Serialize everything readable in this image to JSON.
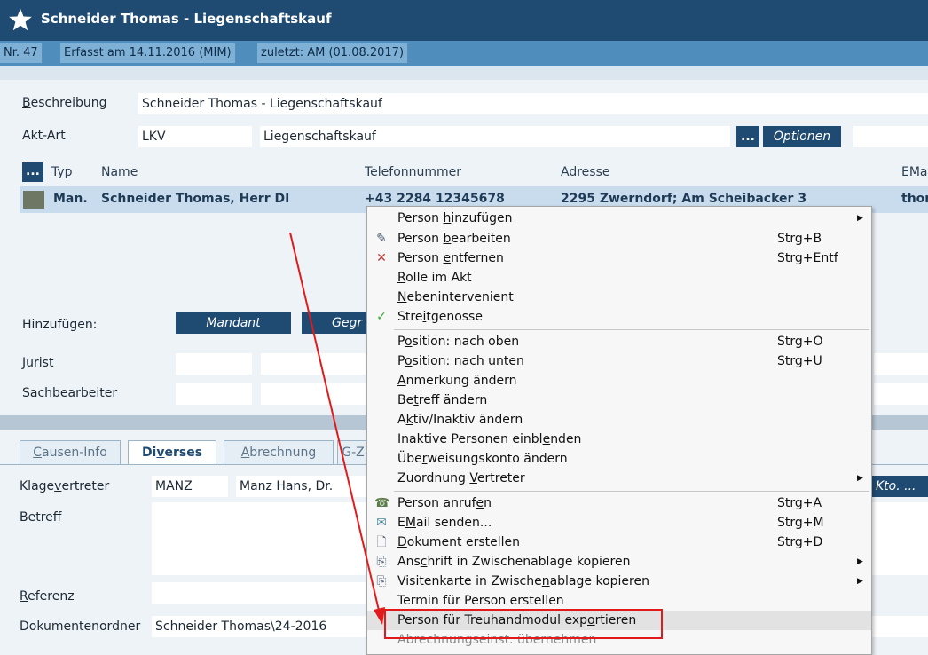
{
  "window": {
    "title": "Schneider Thomas - Liegenschaftskauf",
    "info": [
      "Nr. 47",
      "Erfasst am 14.11.2016 (MIM)",
      "zuletzt: AM (01.08.2017)"
    ]
  },
  "form": {
    "beschreibung_label": "Beschreibung",
    "beschreibung_value": "Schneider Thomas - Liegenschaftskauf",
    "aktart_label": "Akt-Art",
    "aktart_code": "LKV",
    "aktart_value": "Liegenschaftskauf",
    "ellipsis": "...",
    "optionen": "Optionen"
  },
  "persons": {
    "menu_btn": "...",
    "headers": {
      "typ": "Typ",
      "name": "Name",
      "telefon": "Telefonnummer",
      "adresse": "Adresse",
      "email": "EMail"
    },
    "row": {
      "typ": "Man.",
      "name": "Schneider Thomas, Herr DI",
      "telefon": "+43 2284 12345678",
      "adresse": "2295 Zwerndorf; Am Scheibacker 3",
      "email": "thom"
    }
  },
  "add": {
    "label": "Hinzufügen:",
    "mandant": "Mandant",
    "gegner": "Gegr"
  },
  "roles": {
    "jurist": "Jurist",
    "sachbearbeiter": "Sachbearbeiter"
  },
  "tabs": [
    "Causen-Info",
    "Diverses",
    "Abrechnung",
    "G-Z"
  ],
  "lower": {
    "klagevertreter_label": "Klagevertreter",
    "klagevertreter_code": "MANZ",
    "klagevertreter_value": "Manz Hans, Dr.",
    "kto_btn": "Kto. ...",
    "betreff_label": "Betreff",
    "referenz_label": "Referenz",
    "dokumentenordner_label": "Dokumentenordner",
    "dokumentenordner_value": "Schneider Thomas\\24-2016"
  },
  "context_menu": {
    "items": [
      {
        "label": "Person hinzufügen",
        "shortcut": "",
        "submenu": true,
        "icon": ""
      },
      {
        "label": "Person bearbeiten",
        "shortcut": "Strg+B",
        "submenu": false,
        "icon": "pencil-icon"
      },
      {
        "label": "Person entfernen",
        "shortcut": "Strg+Entf",
        "submenu": false,
        "icon": "remove-x-icon"
      },
      {
        "label": "Rolle im Akt",
        "shortcut": "",
        "submenu": false,
        "icon": ""
      },
      {
        "label": "Nebenintervenient",
        "shortcut": "",
        "submenu": false,
        "icon": ""
      },
      {
        "label": "Streitgenosse",
        "shortcut": "",
        "submenu": false,
        "icon": "checkmark-icon"
      },
      {
        "label": "Position: nach oben",
        "shortcut": "Strg+O",
        "submenu": false,
        "icon": ""
      },
      {
        "label": "Position: nach unten",
        "shortcut": "Strg+U",
        "submenu": false,
        "icon": ""
      },
      {
        "label": "Anmerkung ändern",
        "shortcut": "",
        "submenu": false,
        "icon": ""
      },
      {
        "label": "Betreff ändern",
        "shortcut": "",
        "submenu": false,
        "icon": ""
      },
      {
        "label": "Aktiv/Inaktiv ändern",
        "shortcut": "",
        "submenu": false,
        "icon": ""
      },
      {
        "label": "Inaktive Personen einblenden",
        "shortcut": "",
        "submenu": false,
        "icon": ""
      },
      {
        "label": "Überweisungskonto ändern",
        "shortcut": "",
        "submenu": false,
        "icon": ""
      },
      {
        "label": "Zuordnung Vertreter",
        "shortcut": "",
        "submenu": true,
        "icon": ""
      },
      {
        "label": "Person anrufen",
        "shortcut": "Strg+A",
        "submenu": false,
        "icon": "phone-icon"
      },
      {
        "label": "EMail senden...",
        "shortcut": "Strg+M",
        "submenu": false,
        "icon": "mail-icon"
      },
      {
        "label": "Dokument erstellen",
        "shortcut": "Strg+D",
        "submenu": false,
        "icon": "document-icon"
      },
      {
        "label": "Anschrift in Zwischenablage kopieren",
        "shortcut": "",
        "submenu": true,
        "icon": "copy-icon"
      },
      {
        "label": "Visitenkarte in Zwischenablage kopieren",
        "shortcut": "",
        "submenu": true,
        "icon": "copy-icon"
      },
      {
        "label": "Termin für Person erstellen",
        "shortcut": "",
        "submenu": false,
        "icon": ""
      },
      {
        "label": "Person für Treuhandmodul exportieren",
        "shortcut": "",
        "submenu": false,
        "icon": ""
      },
      {
        "label": "Abrechnungseinst. übernehmen",
        "shortcut": "",
        "submenu": false,
        "icon": ""
      }
    ],
    "highlight_color": "#e11b1b"
  }
}
